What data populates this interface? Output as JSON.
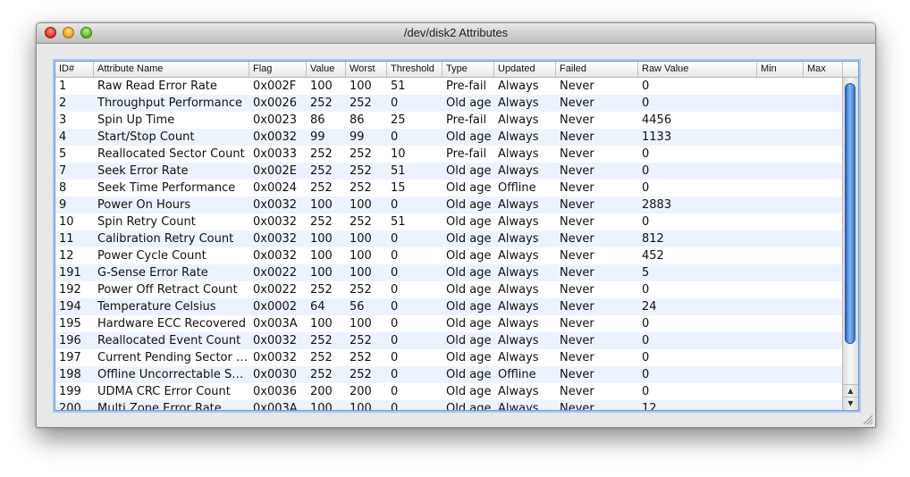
{
  "window": {
    "title": "/dev/disk2 Attributes"
  },
  "columns": [
    "ID#",
    "Attribute Name",
    "Flag",
    "Value",
    "Worst",
    "Threshold",
    "Type",
    "Updated",
    "Failed",
    "Raw Value",
    "Min",
    "Max"
  ],
  "rows": [
    [
      "1",
      "Raw Read Error Rate",
      "0x002F",
      "100",
      "100",
      "51",
      "Pre-fail",
      "Always",
      "Never",
      "0"
    ],
    [
      "2",
      "Throughput Performance",
      "0x0026",
      "252",
      "252",
      "0",
      "Old age",
      "Always",
      "Never",
      "0"
    ],
    [
      "3",
      "Spin Up Time",
      "0x0023",
      "86",
      "86",
      "25",
      "Pre-fail",
      "Always",
      "Never",
      "4456"
    ],
    [
      "4",
      "Start/Stop Count",
      "0x0032",
      "99",
      "99",
      "0",
      "Old age",
      "Always",
      "Never",
      "1133"
    ],
    [
      "5",
      "Reallocated Sector Count",
      "0x0033",
      "252",
      "252",
      "10",
      "Pre-fail",
      "Always",
      "Never",
      "0"
    ],
    [
      "7",
      "Seek Error Rate",
      "0x002E",
      "252",
      "252",
      "51",
      "Old age",
      "Always",
      "Never",
      "0"
    ],
    [
      "8",
      "Seek Time Performance",
      "0x0024",
      "252",
      "252",
      "15",
      "Old age",
      "Offline",
      "Never",
      "0"
    ],
    [
      "9",
      "Power On Hours",
      "0x0032",
      "100",
      "100",
      "0",
      "Old age",
      "Always",
      "Never",
      "2883"
    ],
    [
      "10",
      "Spin Retry Count",
      "0x0032",
      "252",
      "252",
      "51",
      "Old age",
      "Always",
      "Never",
      "0"
    ],
    [
      "11",
      "Calibration Retry Count",
      "0x0032",
      "100",
      "100",
      "0",
      "Old age",
      "Always",
      "Never",
      "812"
    ],
    [
      "12",
      "Power Cycle Count",
      "0x0032",
      "100",
      "100",
      "0",
      "Old age",
      "Always",
      "Never",
      "452"
    ],
    [
      "191",
      "G-Sense Error Rate",
      "0x0022",
      "100",
      "100",
      "0",
      "Old age",
      "Always",
      "Never",
      "5"
    ],
    [
      "192",
      "Power Off Retract Count",
      "0x0022",
      "252",
      "252",
      "0",
      "Old age",
      "Always",
      "Never",
      "0"
    ],
    [
      "194",
      "Temperature Celsius",
      "0x0002",
      "64",
      "56",
      "0",
      "Old age",
      "Always",
      "Never",
      "24"
    ],
    [
      "195",
      "Hardware ECC Recovered",
      "0x003A",
      "100",
      "100",
      "0",
      "Old age",
      "Always",
      "Never",
      "0"
    ],
    [
      "196",
      "Reallocated Event Count",
      "0x0032",
      "252",
      "252",
      "0",
      "Old age",
      "Always",
      "Never",
      "0"
    ],
    [
      "197",
      "Current Pending Sector …",
      "0x0032",
      "252",
      "252",
      "0",
      "Old age",
      "Always",
      "Never",
      "0"
    ],
    [
      "198",
      "Offline Uncorrectable Se…",
      "0x0030",
      "252",
      "252",
      "0",
      "Old age",
      "Offline",
      "Never",
      "0"
    ],
    [
      "199",
      "UDMA CRC Error Count",
      "0x0036",
      "200",
      "200",
      "0",
      "Old age",
      "Always",
      "Never",
      "0"
    ],
    [
      "200",
      "Multi Zone Error Rate",
      "0x003A",
      "100",
      "100",
      "0",
      "Old age",
      "Always",
      "Never",
      "12"
    ]
  ],
  "scrollbar": {
    "up_arrow": "▲",
    "down_arrow": "▼"
  },
  "icons": [
    "close-icon",
    "minimize-icon",
    "zoom-icon",
    "resize-grip-icon"
  ]
}
